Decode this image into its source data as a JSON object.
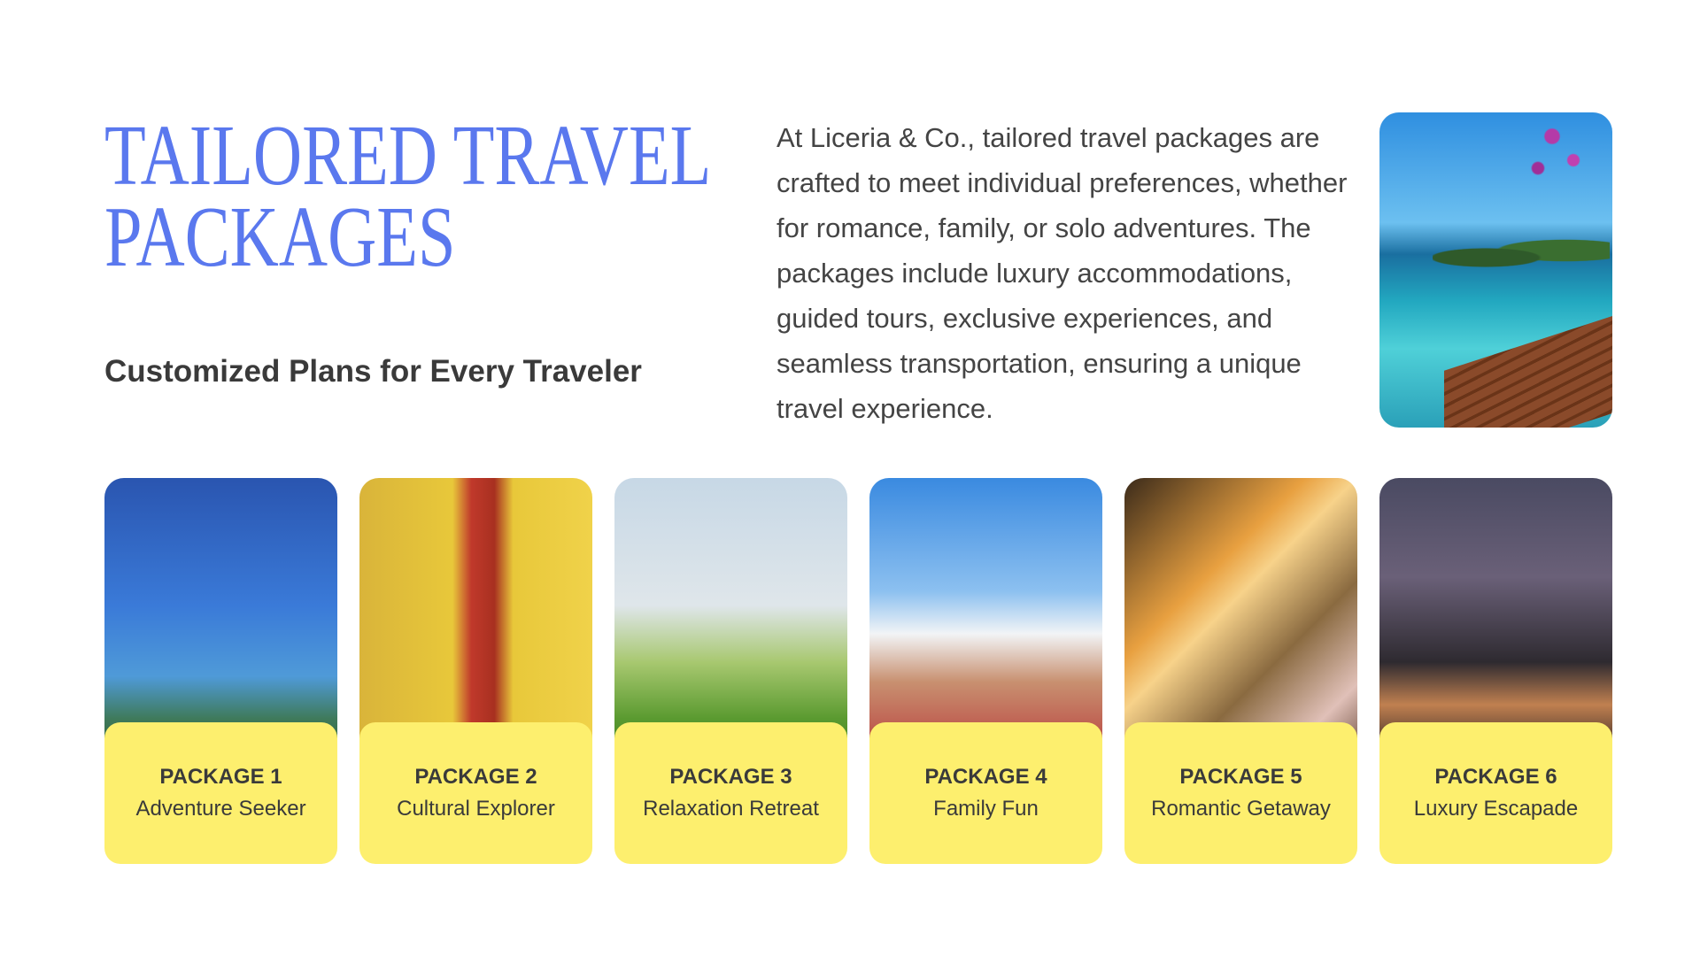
{
  "title": {
    "line1": "TAILORED TRAVEL",
    "line2": "PACKAGES"
  },
  "subtitle": "Customized Plans for Every Traveler",
  "description": "At Liceria & Co., tailored travel packages are crafted to meet individual preferences, whether for romance, family, or solo adventures. The packages include luxury accommodations, guided tours, exclusive experiences, and seamless transportation, ensuring a unique travel experience.",
  "colors": {
    "title": "#5a78ee",
    "card_label": "#fdef6e",
    "text": "#3a3a3a"
  },
  "packages": [
    {
      "number": "PACKAGE 1",
      "name": "Adventure Seeker"
    },
    {
      "number": "PACKAGE 2",
      "name": "Cultural Explorer"
    },
    {
      "number": "PACKAGE 3",
      "name": "Relaxation Retreat"
    },
    {
      "number": "PACKAGE 4",
      "name": "Family Fun"
    },
    {
      "number": "PACKAGE 5",
      "name": "Romantic Getaway"
    },
    {
      "number": "PACKAGE 6",
      "name": "Luxury Escapade"
    }
  ]
}
